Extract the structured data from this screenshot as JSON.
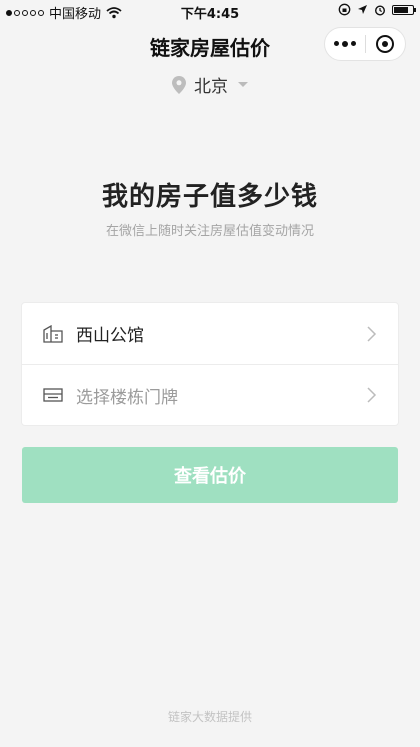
{
  "status_bar": {
    "carrier": "中国移动",
    "time": "下午4:45"
  },
  "nav": {
    "title": "链家房屋估价"
  },
  "location": {
    "city": "北京"
  },
  "hero": {
    "title": "我的房子值多少钱",
    "subtitle": "在微信上随时关注房屋估值变动情况"
  },
  "form": {
    "community": {
      "value": "西山公馆",
      "icon": "building-icon"
    },
    "unit": {
      "placeholder": "选择楼栋门牌",
      "icon": "door-plate-icon"
    }
  },
  "actions": {
    "submit_label": "查看估价",
    "submit_color": "#9fe0c1"
  },
  "footer": {
    "text": "链家大数据提供"
  }
}
